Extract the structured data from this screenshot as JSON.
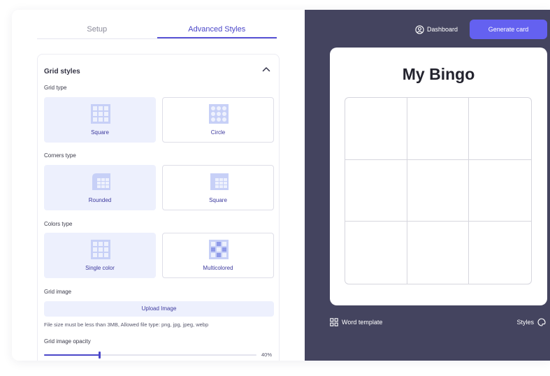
{
  "tabs": [
    {
      "label": "Setup"
    },
    {
      "label": "Advanced Styles"
    }
  ],
  "panel": {
    "title": "Grid styles",
    "grid_type": {
      "label": "Grid type",
      "options": [
        {
          "label": "Square",
          "icon": "square-grid-icon",
          "selected": true
        },
        {
          "label": "Circle",
          "icon": "circle-grid-icon",
          "selected": false
        }
      ]
    },
    "corners_type": {
      "label": "Corners type",
      "options": [
        {
          "label": "Rounded",
          "icon": "rounded-corner-icon",
          "selected": true
        },
        {
          "label": "Square",
          "icon": "square-corner-icon",
          "selected": false
        }
      ]
    },
    "colors_type": {
      "label": "Colors type",
      "options": [
        {
          "label": "Single color",
          "icon": "single-color-grid-icon",
          "selected": true
        },
        {
          "label": "Multicolored",
          "icon": "multicolor-grid-icon",
          "selected": false
        }
      ]
    },
    "grid_image": {
      "label": "Grid image",
      "upload_label": "Upload Image",
      "hint": "File size must be less than 3MB, Allowed file type: png, jpg, jpeg, webp"
    },
    "opacity": {
      "label": "Grid image opacity",
      "value": 0.4,
      "value_text": "40%"
    }
  },
  "header": {
    "dashboard_label": "Dashboard",
    "generate_label": "Generate card"
  },
  "card": {
    "title": "My Bingo",
    "rows": 3,
    "cols": 3
  },
  "footer": {
    "word_template_label": "Word template",
    "styles_label": "Styles"
  },
  "colors": {
    "accent": "#5a55d6",
    "button": "#6461f0",
    "sidebar_bg": "#44445f",
    "selected_bg": "#edf0fd",
    "icon_fill": "#c7d0f7"
  }
}
